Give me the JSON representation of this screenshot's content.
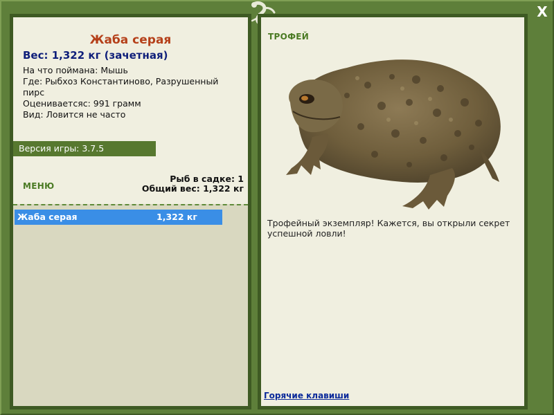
{
  "window": {
    "close_label": "X"
  },
  "catch": {
    "title": "Жаба серая",
    "weight": "Вес: 1,322 кг (зачетная)",
    "details": [
      "На что поймана: Мышь",
      "Где: Рыбхоз Константиново, Разрушенный пирс",
      "Оцениваетсяс: 991 грамм",
      "Вид: Ловится не часто"
    ]
  },
  "version": "Версия игры: 3.7.5",
  "menu_label": "МЕНЮ",
  "stats": {
    "count": "Рыб в садке: 1",
    "total_weight": "Общий вес: 1,322 кг"
  },
  "list": [
    {
      "name": "Жаба серая",
      "weight": "1,322 кг"
    }
  ],
  "trophy": {
    "label": "ТРОФЕЙ",
    "description": "Трофейный экземпляр! Кажется, вы открыли секрет успешной ловли!",
    "hotkeys_link": "Горячие клавиши"
  },
  "colors": {
    "frame": "#5e7f3a",
    "panel": "#f0efe0",
    "title": "#b5401a",
    "weight": "#0f1f7a",
    "selected_row": "#3a8ee6"
  },
  "icons": [
    "close-icon",
    "lizard-logo-icon",
    "toad-image"
  ]
}
